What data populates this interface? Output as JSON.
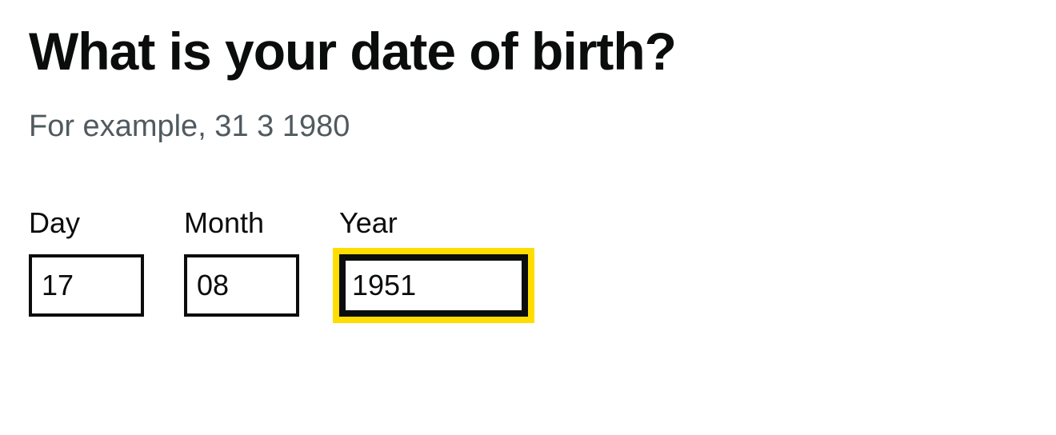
{
  "heading": "What is your date of birth?",
  "hint": "For example, 31 3 1980",
  "fields": {
    "day": {
      "label": "Day",
      "value": "17"
    },
    "month": {
      "label": "Month",
      "value": "08"
    },
    "year": {
      "label": "Year",
      "value": "1951"
    }
  }
}
